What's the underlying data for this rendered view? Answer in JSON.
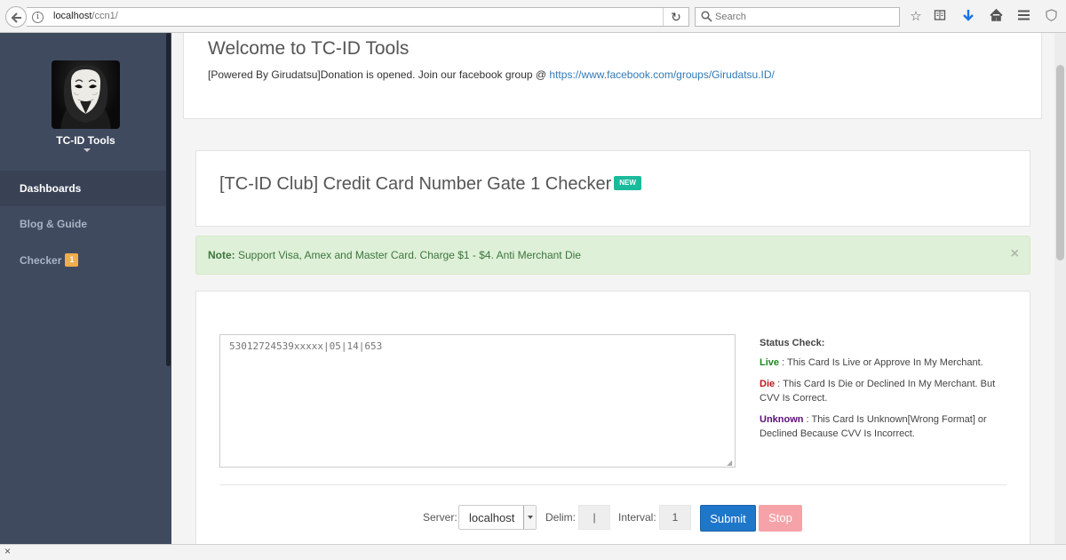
{
  "browser": {
    "url_host": "localhost",
    "url_path": "/ccn1/",
    "search_placeholder": "Search",
    "reload_glyph": "↻",
    "icons": [
      "back-icon",
      "info-icon",
      "reload-icon",
      "search-icon",
      "bookmark-star-icon",
      "reading-list-icon",
      "download-icon",
      "home-icon",
      "menu-icon",
      "shield-icon"
    ]
  },
  "sidebar": {
    "profile_name": "TC-ID Tools",
    "items": [
      {
        "label": "Dashboards",
        "active": true
      },
      {
        "label": "Blog & Guide"
      },
      {
        "label": "Checker",
        "badge": "1"
      }
    ]
  },
  "welcome": {
    "title": "Welcome to TC-ID Tools",
    "text": "[Powered By Girudatsu]Donation is opened. Join our facebook group @ ",
    "link": "https://www.facebook.com/groups/Girudatsu.ID/"
  },
  "gate": {
    "title": "[TC-ID Club] Credit Card Number Gate 1 Checker",
    "badge": "NEW"
  },
  "alert": {
    "bold": "Note:",
    "text": " Support Visa, Amex and Master Card. Charge $1 - $4. Anti Merchant Die",
    "close": "×"
  },
  "checker": {
    "input_placeholder": "53012724539xxxxx|05|14|653",
    "status_head": "Status Check:",
    "live_label": "Live",
    "live_text": " : This Card Is Live or Approve In My Merchant.",
    "die_label": "Die",
    "die_text": " : This Card Is Die or Declined In My Merchant. But CVV Is Correct.",
    "unknown_label": "Unknown",
    "unknown_text": " : This Card Is Unknown[Wrong Format] or Declined Because CVV Is Incorrect.",
    "server_label": "Server:",
    "server_value": "localhost",
    "delim_label": "Delim:",
    "delim_value": "|",
    "interval_label": "Interval:",
    "interval_value": "1",
    "submit_label": "Submit",
    "stop_label": "Stop"
  },
  "bottom": {
    "close": "×"
  },
  "colors": {
    "sidebar": "#404a5f",
    "submit": "#1f77c9",
    "stop": "#f5a3a8",
    "new_badge": "#1abb9c",
    "checker_badge": "#f0ad4e",
    "alert_bg": "#dff0d8"
  }
}
